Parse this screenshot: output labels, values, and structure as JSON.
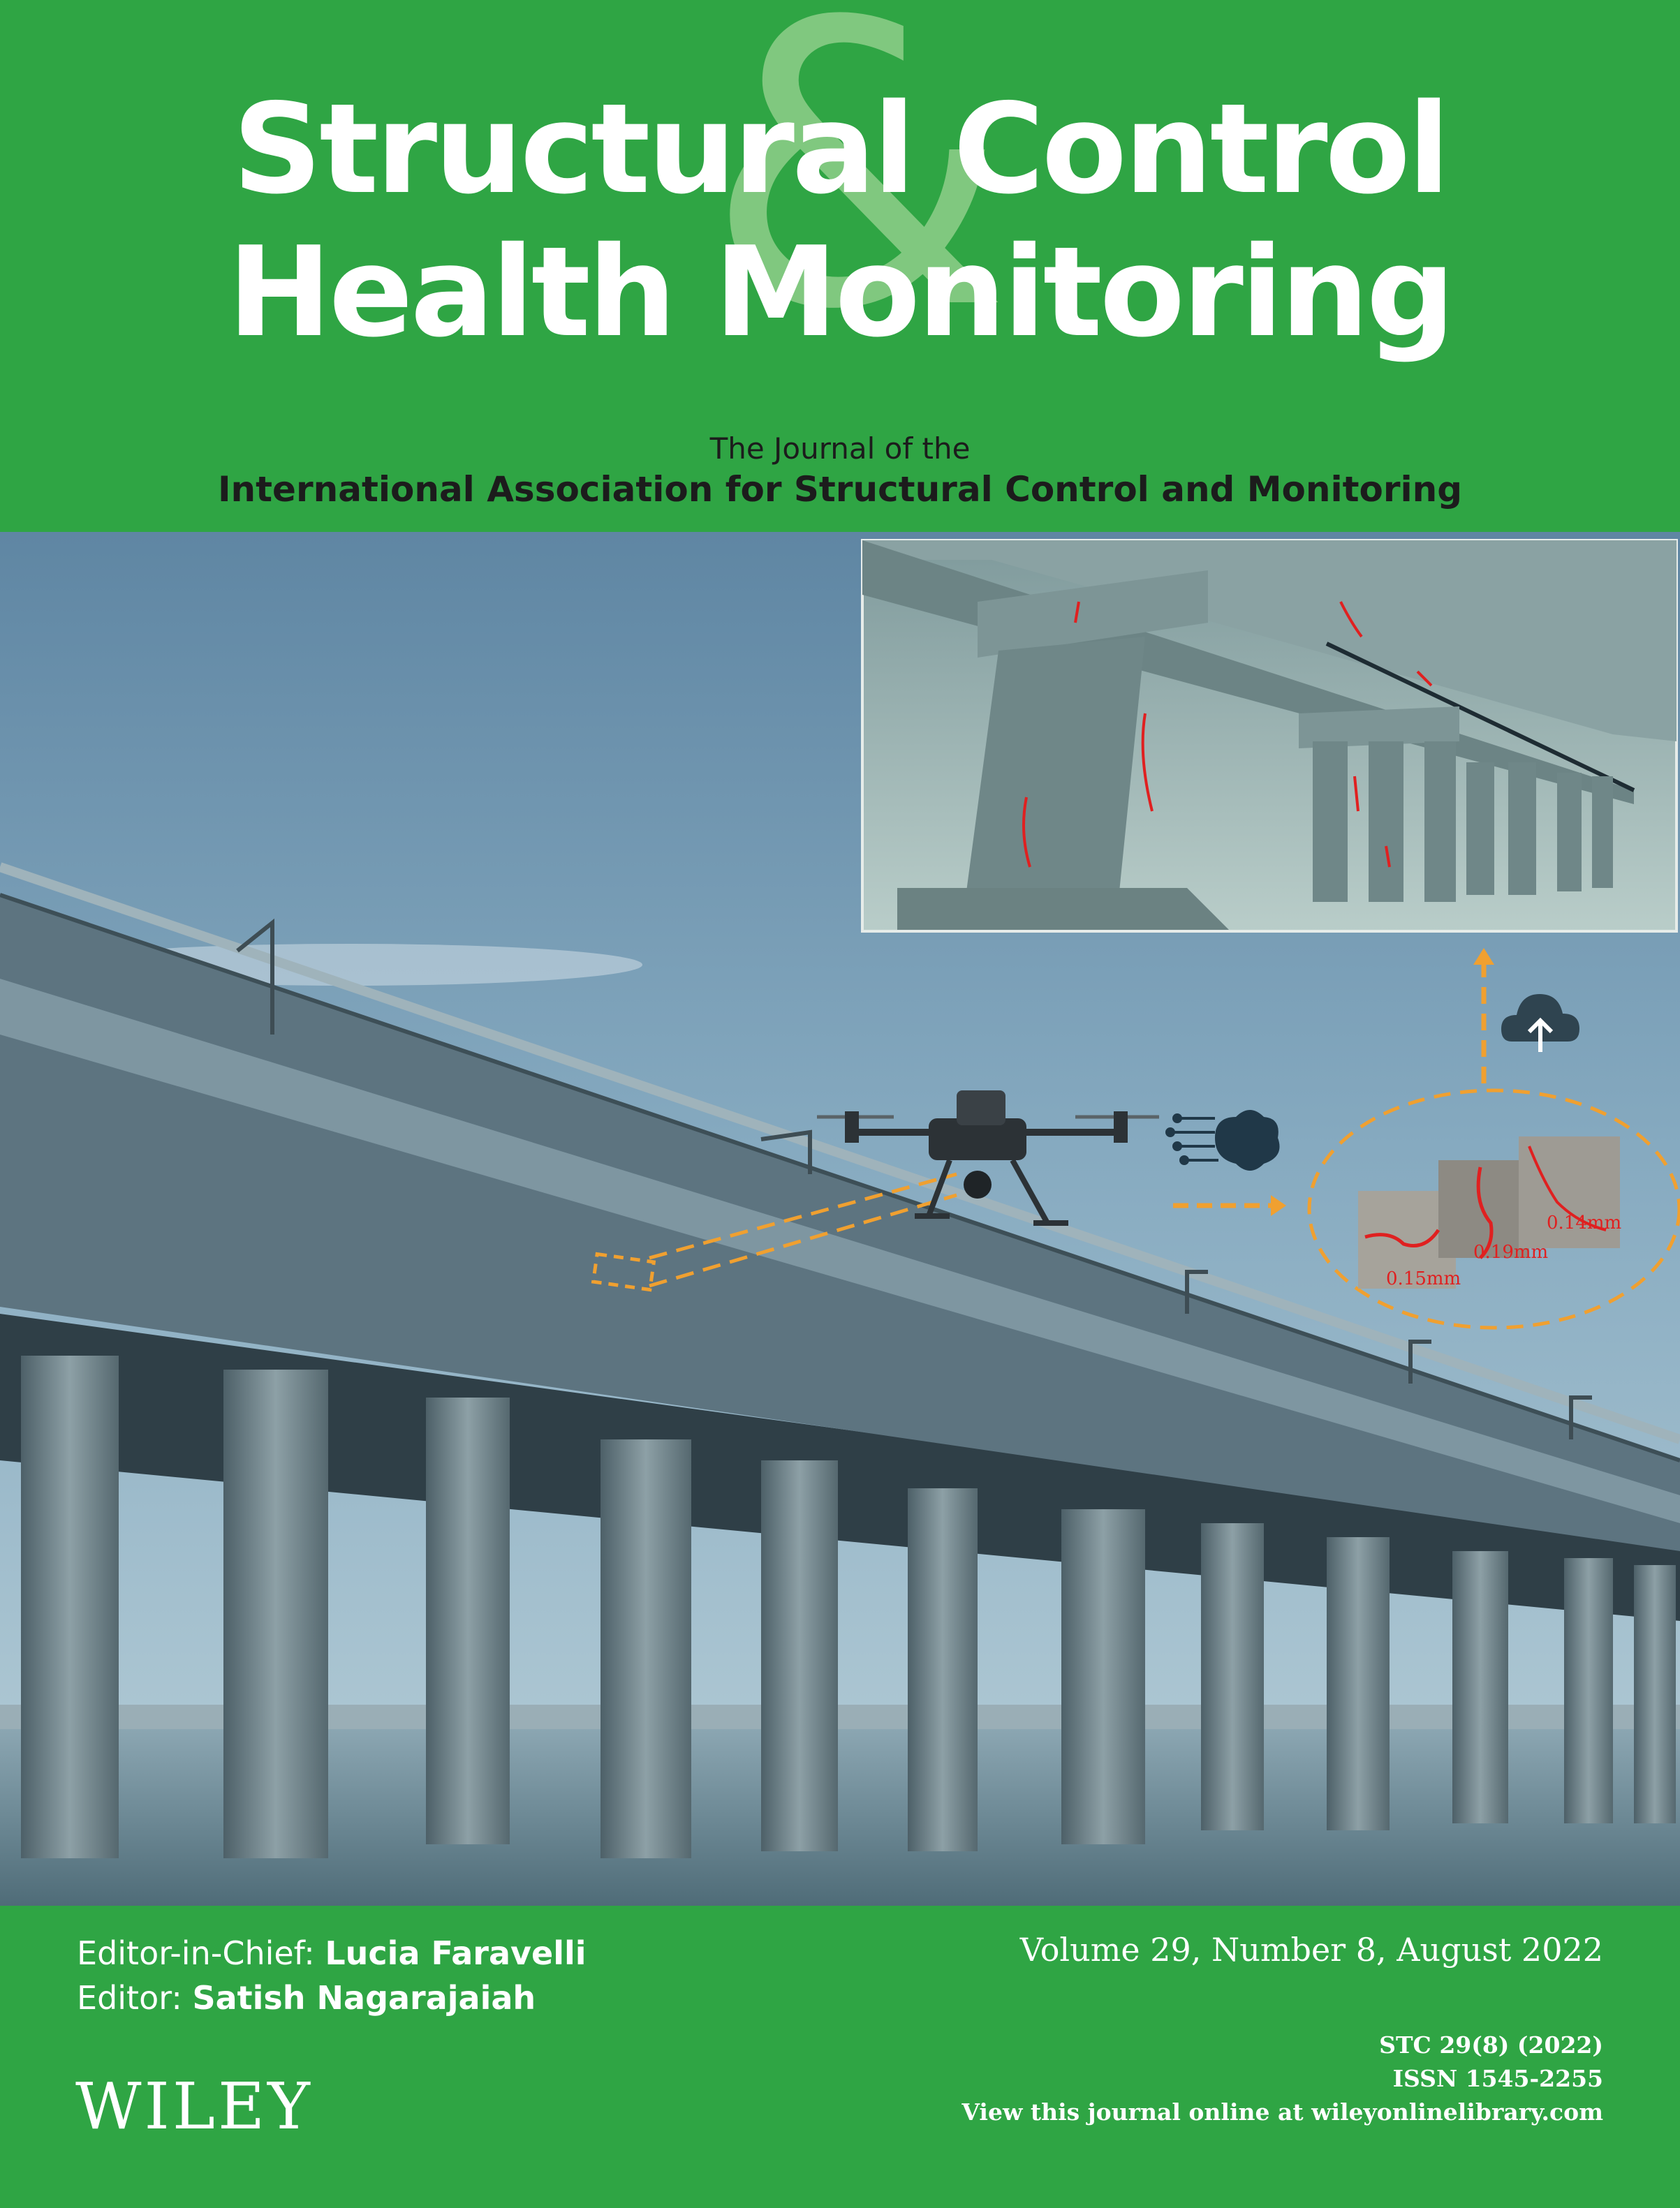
{
  "journal": {
    "title_line1": "Structural Control",
    "title_line2": "Health Monitoring",
    "ampersand": "&",
    "subtitle_line1": "The Journal of the",
    "subtitle_line2": "International Association for Structural Control and Monitoring"
  },
  "illustration": {
    "crack_labels": [
      "0.14mm",
      "0.19mm",
      "0.15mm"
    ],
    "icons": [
      "drone-icon",
      "ai-brain-icon",
      "cloud-upload-icon"
    ],
    "colors": {
      "masthead_green": "#2fa544",
      "ampersand_green": "#8fcf8a",
      "dashed_orange": "#f0a030",
      "crack_red": "#e02020"
    }
  },
  "editors": {
    "chief_label": "Editor-in-Chief:",
    "chief_name": "Lucia Faravelli",
    "editor_label": "Editor:",
    "editor_name": "Satish Nagarajaiah"
  },
  "issue": {
    "volume_line": "Volume 29, Number 8,  August 2022"
  },
  "publisher": {
    "name": "WILEY",
    "citation": "STC 29(8) (2022)",
    "issn": "ISSN 1545-2255",
    "online": "View this journal online at wileyonlinelibrary.com"
  }
}
